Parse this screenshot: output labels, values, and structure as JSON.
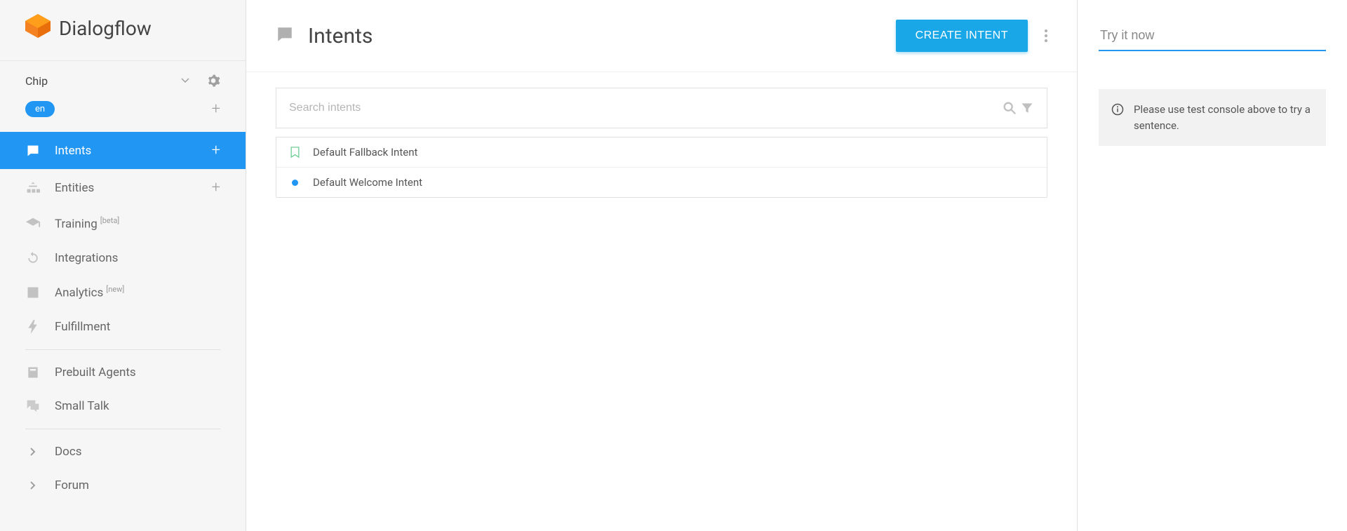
{
  "brand": "Dialogflow",
  "agent": {
    "name": "Chip",
    "language": "en"
  },
  "nav": {
    "intents": "Intents",
    "entities": "Entities",
    "training": "Training",
    "trainingBadge": "[beta]",
    "integrations": "Integrations",
    "analytics": "Analytics",
    "analyticsBadge": "[new]",
    "fulfillment": "Fulfillment",
    "prebuilt": "Prebuilt Agents",
    "smalltalk": "Small Talk",
    "docs": "Docs",
    "forum": "Forum"
  },
  "header": {
    "title": "Intents",
    "createLabel": "CREATE INTENT"
  },
  "search": {
    "placeholder": "Search intents"
  },
  "intents": [
    {
      "name": "Default Fallback Intent",
      "icon": "bookmark"
    },
    {
      "name": "Default Welcome Intent",
      "icon": "dot"
    }
  ],
  "testConsole": {
    "placeholder": "Try it now",
    "hint": "Please use test console above to try a sentence."
  }
}
